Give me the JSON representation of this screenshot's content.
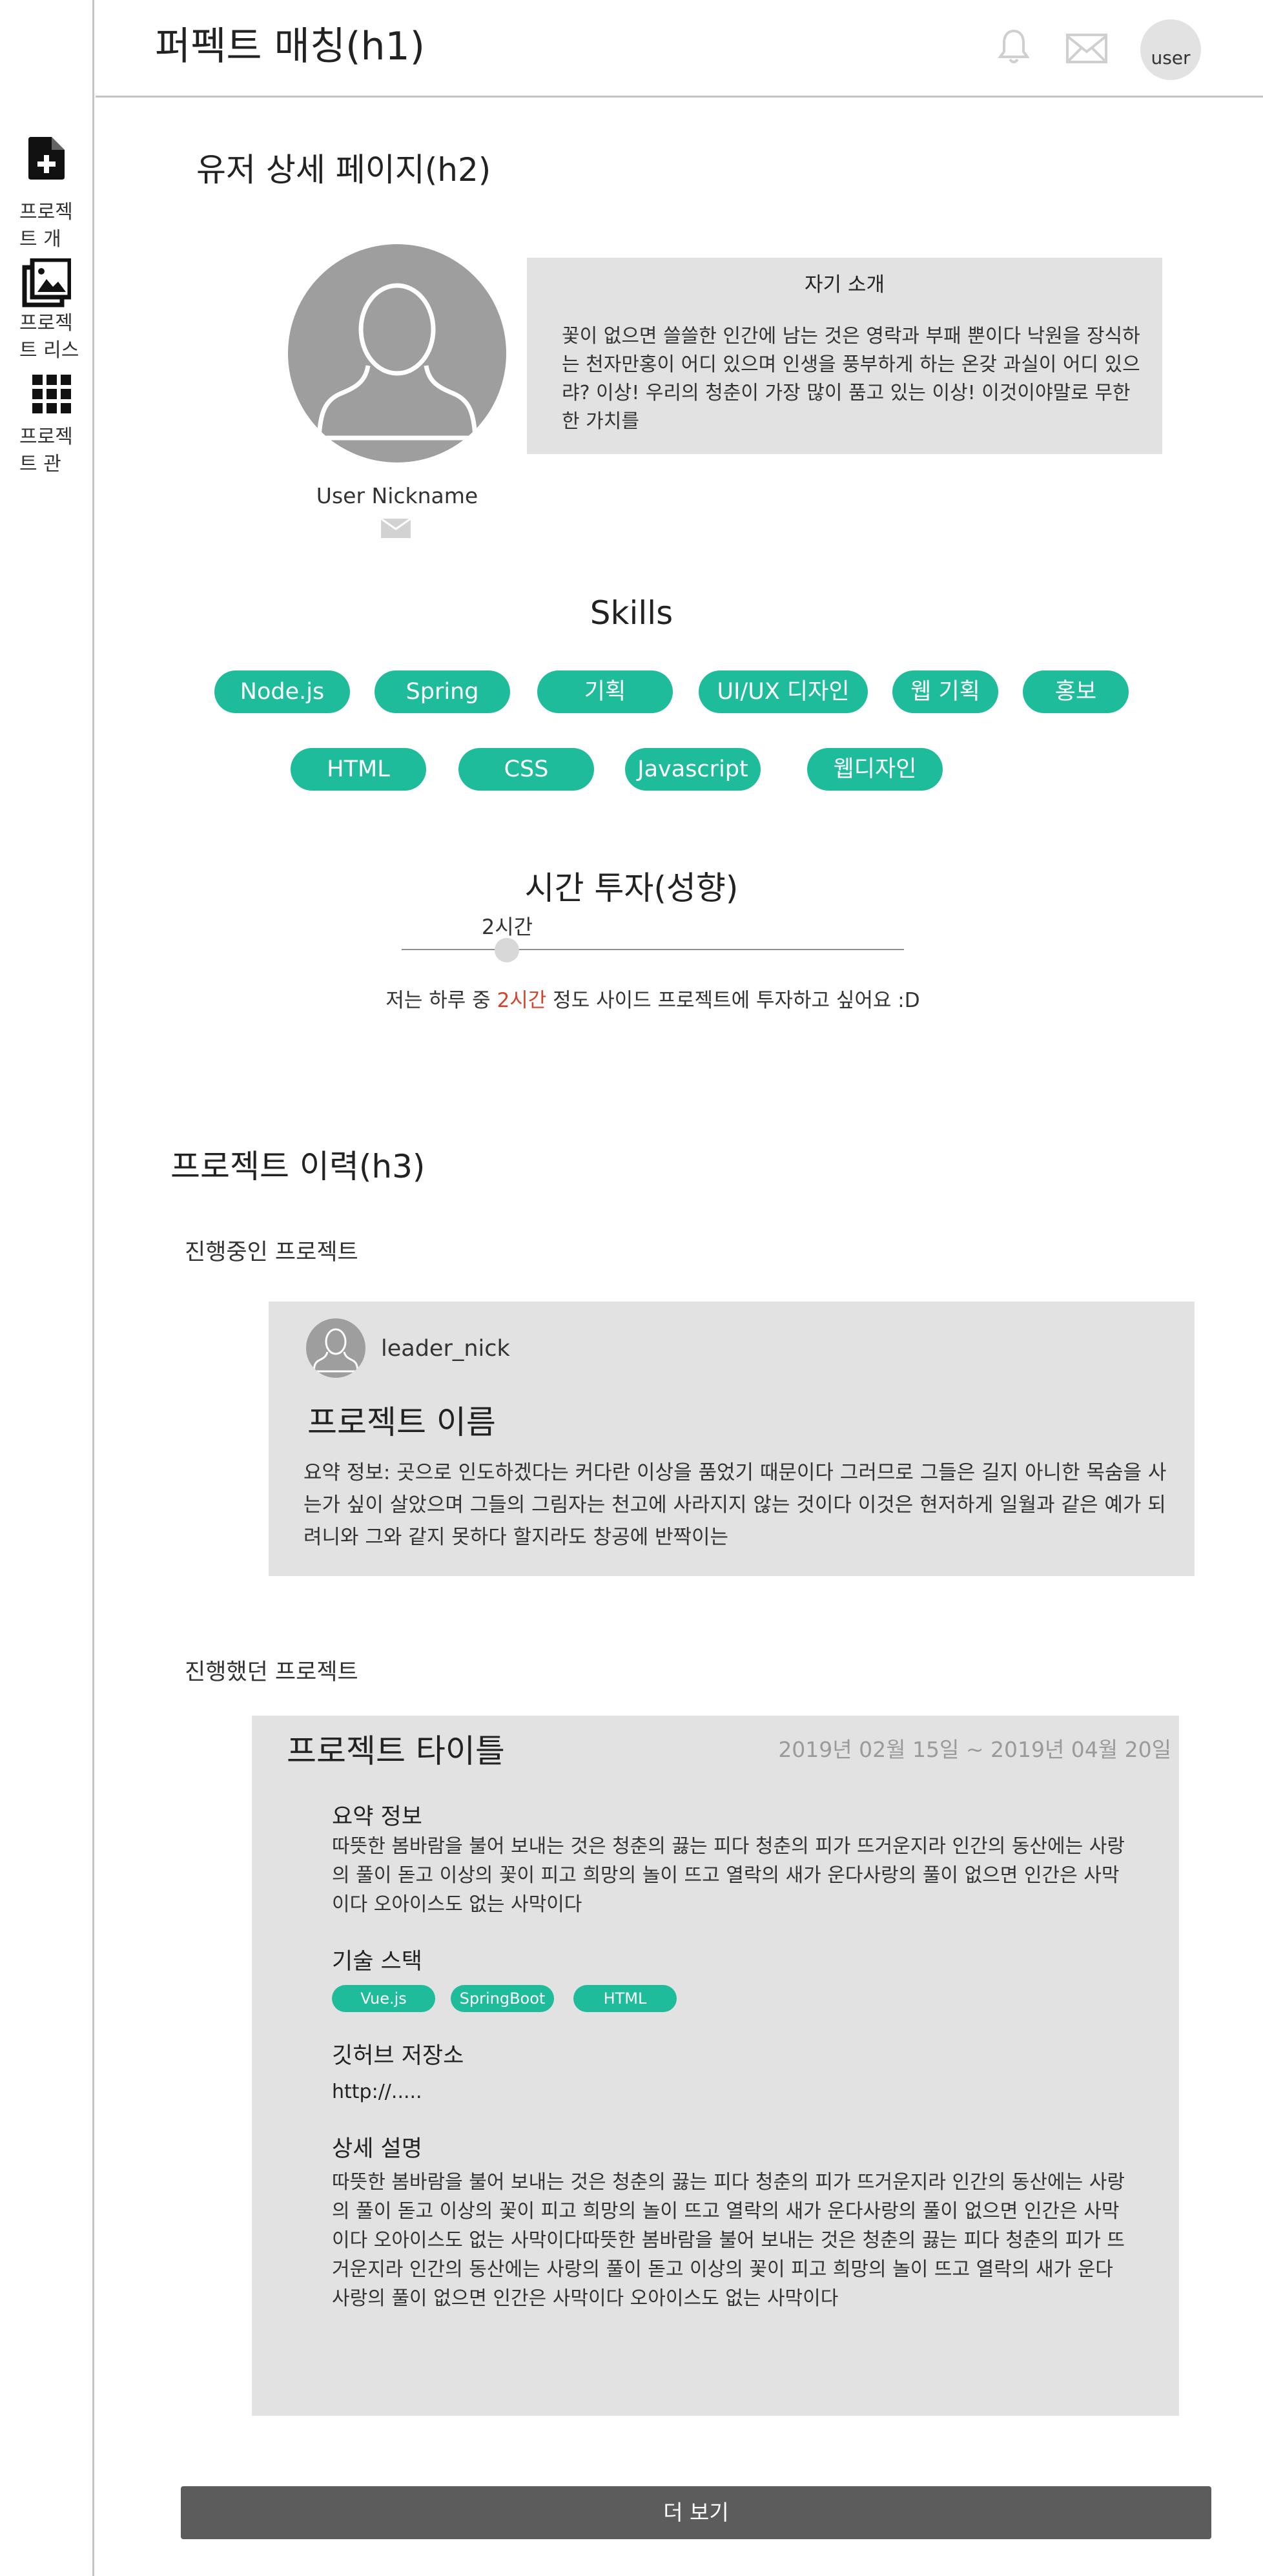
{
  "sidebar": {
    "items": [
      {
        "icon": "add-document-icon",
        "label": "프로젝트 개"
      },
      {
        "icon": "image-gallery-icon",
        "label": "프로젝트 리스"
      },
      {
        "icon": "grid-icon",
        "label": "프로젝트 관"
      }
    ]
  },
  "header": {
    "title": "퍼펙트 매칭(h1)",
    "user_label": "user",
    "icons": [
      "bell-icon",
      "mail-icon"
    ]
  },
  "profile": {
    "page_title": "유저 상세 페이지(h2)",
    "nickname": "User Nickname",
    "intro_title": "자기 소개",
    "intro_text": "꽃이 없으면 쓸쓸한 인간에 남는 것은 영락과 부패 뿐이다 낙원을 장식하는 천자만홍이 어디 있으며 인생을 풍부하게 하는 온갖 과실이 어디 있으랴? 이상! 우리의 청춘이 가장 많이 품고 있는 이상! 이것이야말로 무한한 가치를"
  },
  "skills": {
    "title": "Skills",
    "items": [
      "Node.js",
      "Spring",
      "기획",
      "UI/UX 디자인",
      "웹 기획",
      "홍보",
      "HTML",
      "CSS",
      "Javascript",
      "웹디자인"
    ]
  },
  "time": {
    "title": "시간 투자(성향)",
    "slider_label": "2시간",
    "slider_fraction": 0.21,
    "sentence_before": "저는 하루 중 ",
    "sentence_highlight": "2시간",
    "sentence_after": " 정도 사이드 프로젝트에 투자하고 싶어요 :D",
    "accent_color": "#d0452e"
  },
  "history": {
    "title": "프로젝트 이력(h3)",
    "current_label": "진행중인 프로젝트",
    "current": {
      "leader": "leader_nick",
      "name": "프로젝트 이름",
      "summary": "요약 정보: 곳으로 인도하겠다는 커다란 이상을 품었기 때문이다 그러므로 그들은 길지 아니한 목숨을 사는가 싶이 살았으며 그들의 그림자는 천고에 사라지지 않는 것이다 이것은 현저하게 일월과 같은 예가 되려니와 그와 같지 못하다 할지라도 창공에 반짝이는"
    },
    "past_label": "진행했던 프로젝트",
    "past": {
      "title": "프로젝트 타이틀",
      "date": "2019년 02월 15일 ~ 2019년 04월 20일",
      "summary_label": "요약 정보",
      "summary": "따뜻한 봄바람을 불어 보내는 것은 청춘의 끓는 피다 청춘의 피가 뜨거운지라 인간의 동산에는 사랑의 풀이 돋고 이상의 꽃이 피고 희망의 놀이 뜨고 열락의 새가 운다사랑의 풀이 없으면 인간은 사막이다 오아이스도 없는 사막이다",
      "stack_label": "기술 스택",
      "stack": [
        "Vue.js",
        "SpringBoot",
        "HTML"
      ],
      "github_label": "깃허브 저장소",
      "github_url": "http://.....",
      "detail_label": "상세 설명",
      "detail": "따뜻한 봄바람을 불어 보내는 것은 청춘의 끓는 피다 청춘의 피가 뜨거운지라 인간의 동산에는 사랑의 풀이 돋고 이상의 꽃이 피고 희망의 놀이 뜨고 열락의 새가 운다사랑의 풀이 없으면 인간은 사막이다 오아이스도 없는 사막이다따뜻한 봄바람을 불어 보내는 것은 청춘의 끓는 피다 청춘의 피가 뜨거운지라 인간의 동산에는 사랑의 풀이 돋고 이상의 꽃이 피고 희망의 놀이 뜨고 열락의 새가 운다사랑의 풀이 없으면 인간은 사막이다 오아이스도 없는 사막이다"
    },
    "more_button": "더 보기"
  },
  "colors": {
    "chip": "#1fbc9c",
    "card_bg": "#e2e2e2",
    "avatar_gray": "#9e9e9e",
    "button_bg": "#5c5c5c"
  }
}
